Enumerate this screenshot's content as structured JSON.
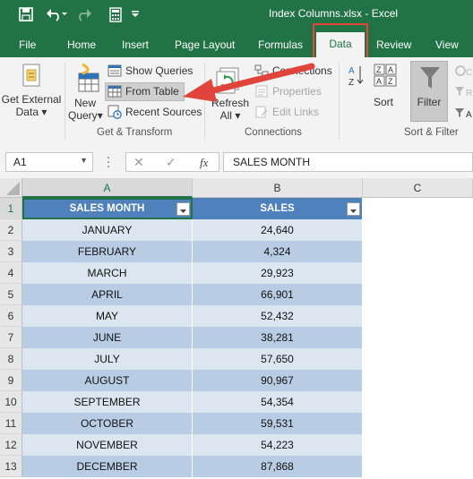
{
  "window": {
    "title": "Index Columns.xlsx - Excel"
  },
  "tabs": [
    "File",
    "Home",
    "Insert",
    "Page Layout",
    "Formulas",
    "Data",
    "Review",
    "View"
  ],
  "active_tab": "Data",
  "ribbon": {
    "get_external_data": [
      "Get External",
      "Data"
    ],
    "new_query": [
      "New",
      "Query"
    ],
    "show_queries": "Show Queries",
    "from_table": "From Table",
    "recent_sources": "Recent Sources",
    "group_get_transform": "Get & Transform",
    "refresh_all": [
      "Refresh",
      "All"
    ],
    "connections": "Connections",
    "properties": "Properties",
    "edit_links": "Edit Links",
    "group_connections": "Connections",
    "sort": "Sort",
    "filter": "Filter",
    "group_sort_filter": "Sort & Filter"
  },
  "formula_bar": {
    "name_box": "A1",
    "fx": "fx",
    "formula": "SALES MONTH"
  },
  "columns": [
    "A",
    "B",
    "C"
  ],
  "table": {
    "headers": [
      "SALES MONTH",
      "SALES"
    ],
    "rows": [
      [
        "JANUARY",
        "24,640"
      ],
      [
        "FEBRUARY",
        "4,324"
      ],
      [
        "MARCH",
        "29,923"
      ],
      [
        "APRIL",
        "66,901"
      ],
      [
        "MAY",
        "52,432"
      ],
      [
        "JUNE",
        "38,281"
      ],
      [
        "JULY",
        "57,650"
      ],
      [
        "AUGUST",
        "90,967"
      ],
      [
        "SEPTEMBER",
        "54,354"
      ],
      [
        "OCTOBER",
        "59,531"
      ],
      [
        "NOVEMBER",
        "54,223"
      ],
      [
        "DECEMBER",
        "87,868"
      ]
    ]
  },
  "row_numbers": [
    "1",
    "2",
    "3",
    "4",
    "5",
    "6",
    "7",
    "8",
    "9",
    "10",
    "11",
    "12",
    "13"
  ],
  "colors": {
    "excel_green": "#217346",
    "table_header": "#4f81bd",
    "band_dark": "#b8cce4",
    "band_light": "#dce6f1",
    "annotation_red": "#e0443b"
  }
}
